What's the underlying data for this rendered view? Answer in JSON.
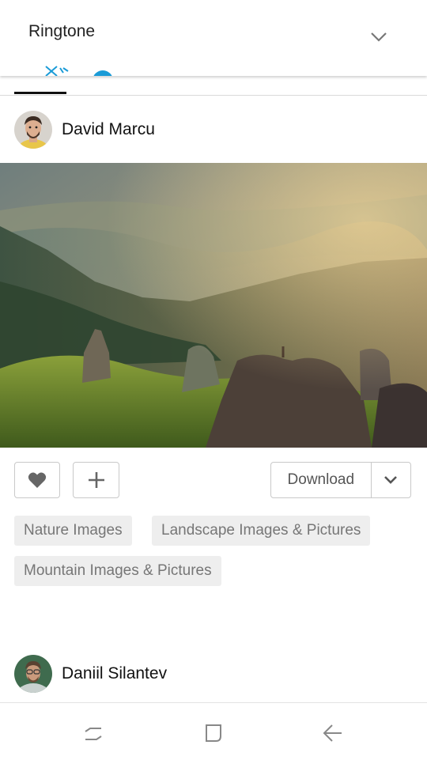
{
  "notification": {
    "title": "Ringtone"
  },
  "posts": [
    {
      "author": "David Marcu"
    },
    {
      "author": "Daniil Silantev"
    }
  ],
  "actions": {
    "download_label": "Download"
  },
  "tags": [
    "Nature Images",
    "Landscape Images & Pictures",
    "Mountain Images & Pictures"
  ],
  "colors": {
    "accent": "#1a9bd7",
    "tag_bg": "#eeeeee",
    "tag_text": "#767676"
  },
  "icons": {
    "chevron": "chevron-down-icon",
    "like": "heart-icon",
    "add": "plus-icon",
    "caret": "chevron-down-icon",
    "nav": [
      "recent-apps-icon",
      "home-icon",
      "back-icon"
    ]
  }
}
